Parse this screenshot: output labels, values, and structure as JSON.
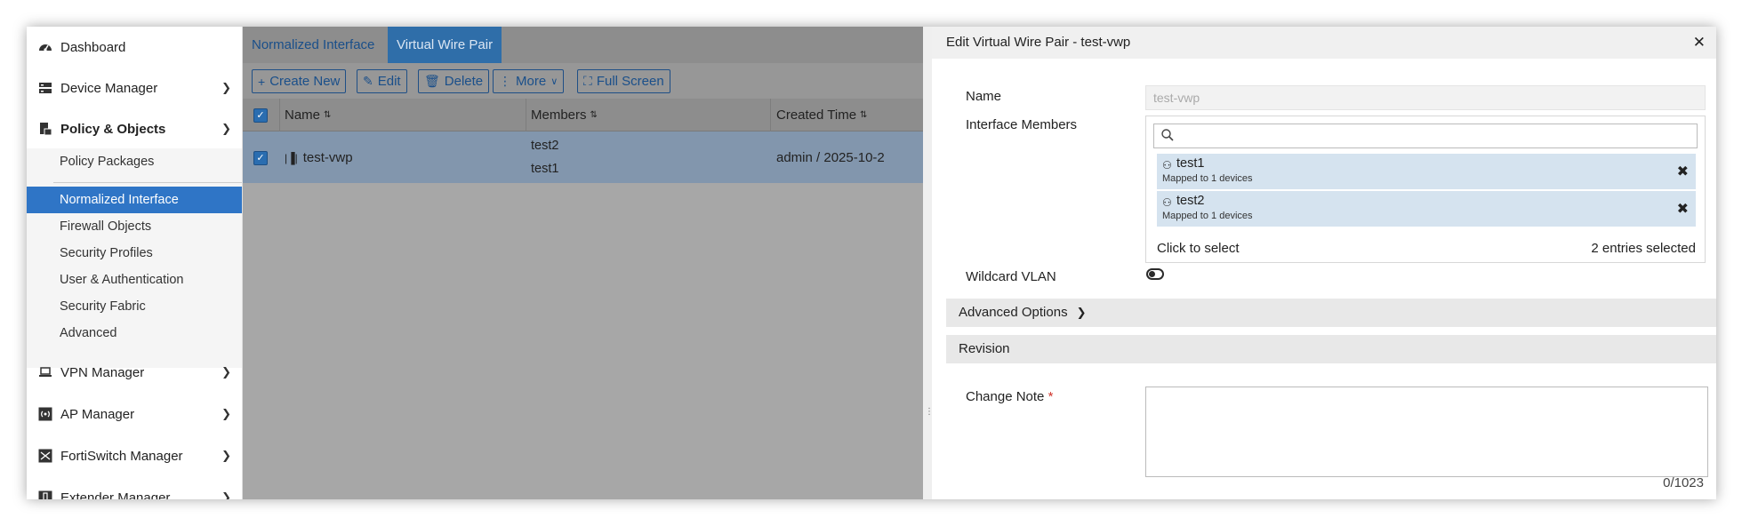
{
  "sidebar": {
    "items": [
      {
        "label": "Dashboard",
        "icon": "dashboard-icon"
      },
      {
        "label": "Device Manager",
        "icon": "device-manager-icon"
      },
      {
        "label": "Policy & Objects",
        "icon": "policy-objects-icon"
      },
      {
        "label": "VPN Manager",
        "icon": "laptop-icon"
      },
      {
        "label": "AP Manager",
        "icon": "wireless-icon"
      },
      {
        "label": "FortiSwitch Manager",
        "icon": "switch-icon"
      },
      {
        "label": "Extender Manager",
        "icon": "extender-icon"
      }
    ],
    "subitems": [
      "Policy Packages",
      "Normalized Interface",
      "Firewall Objects",
      "Security Profiles",
      "User & Authentication",
      "Security Fabric",
      "Advanced"
    ],
    "active_subitem": "Normalized Interface",
    "active_color": "#2f75c6"
  },
  "main": {
    "tabs": [
      {
        "label": "Normalized Interface",
        "active": false
      },
      {
        "label": "Virtual Wire Pair",
        "active": true
      }
    ],
    "toolbar": {
      "create_new": "Create New",
      "edit": "Edit",
      "delete": "Delete",
      "more": "More",
      "full_screen": "Full Screen"
    },
    "columns": [
      "Name",
      "Members",
      "Created Time"
    ],
    "rows": [
      {
        "name": "test-vwp",
        "members": [
          "test2",
          "test1"
        ],
        "created_time": "admin / 2025-10-2"
      }
    ]
  },
  "panel": {
    "title": "Edit Virtual Wire Pair - test-vwp",
    "name_label": "Name",
    "name_value": "test-vwp",
    "members_label": "Interface Members",
    "search_placeholder": "",
    "members": [
      {
        "name": "test1",
        "sub": "Mapped to 1 devices"
      },
      {
        "name": "test2",
        "sub": "Mapped to 1 devices"
      }
    ],
    "click_to_select": "Click to select",
    "entries_selected": "2 entries selected",
    "wildcard_vlan_label": "Wildcard VLAN",
    "wildcard_vlan_on": false,
    "advanced_options": "Advanced Options",
    "revision": "Revision",
    "change_note_label": "Change Note",
    "required_mark": "*",
    "change_note_value": "",
    "char_counter": "0/1023"
  }
}
